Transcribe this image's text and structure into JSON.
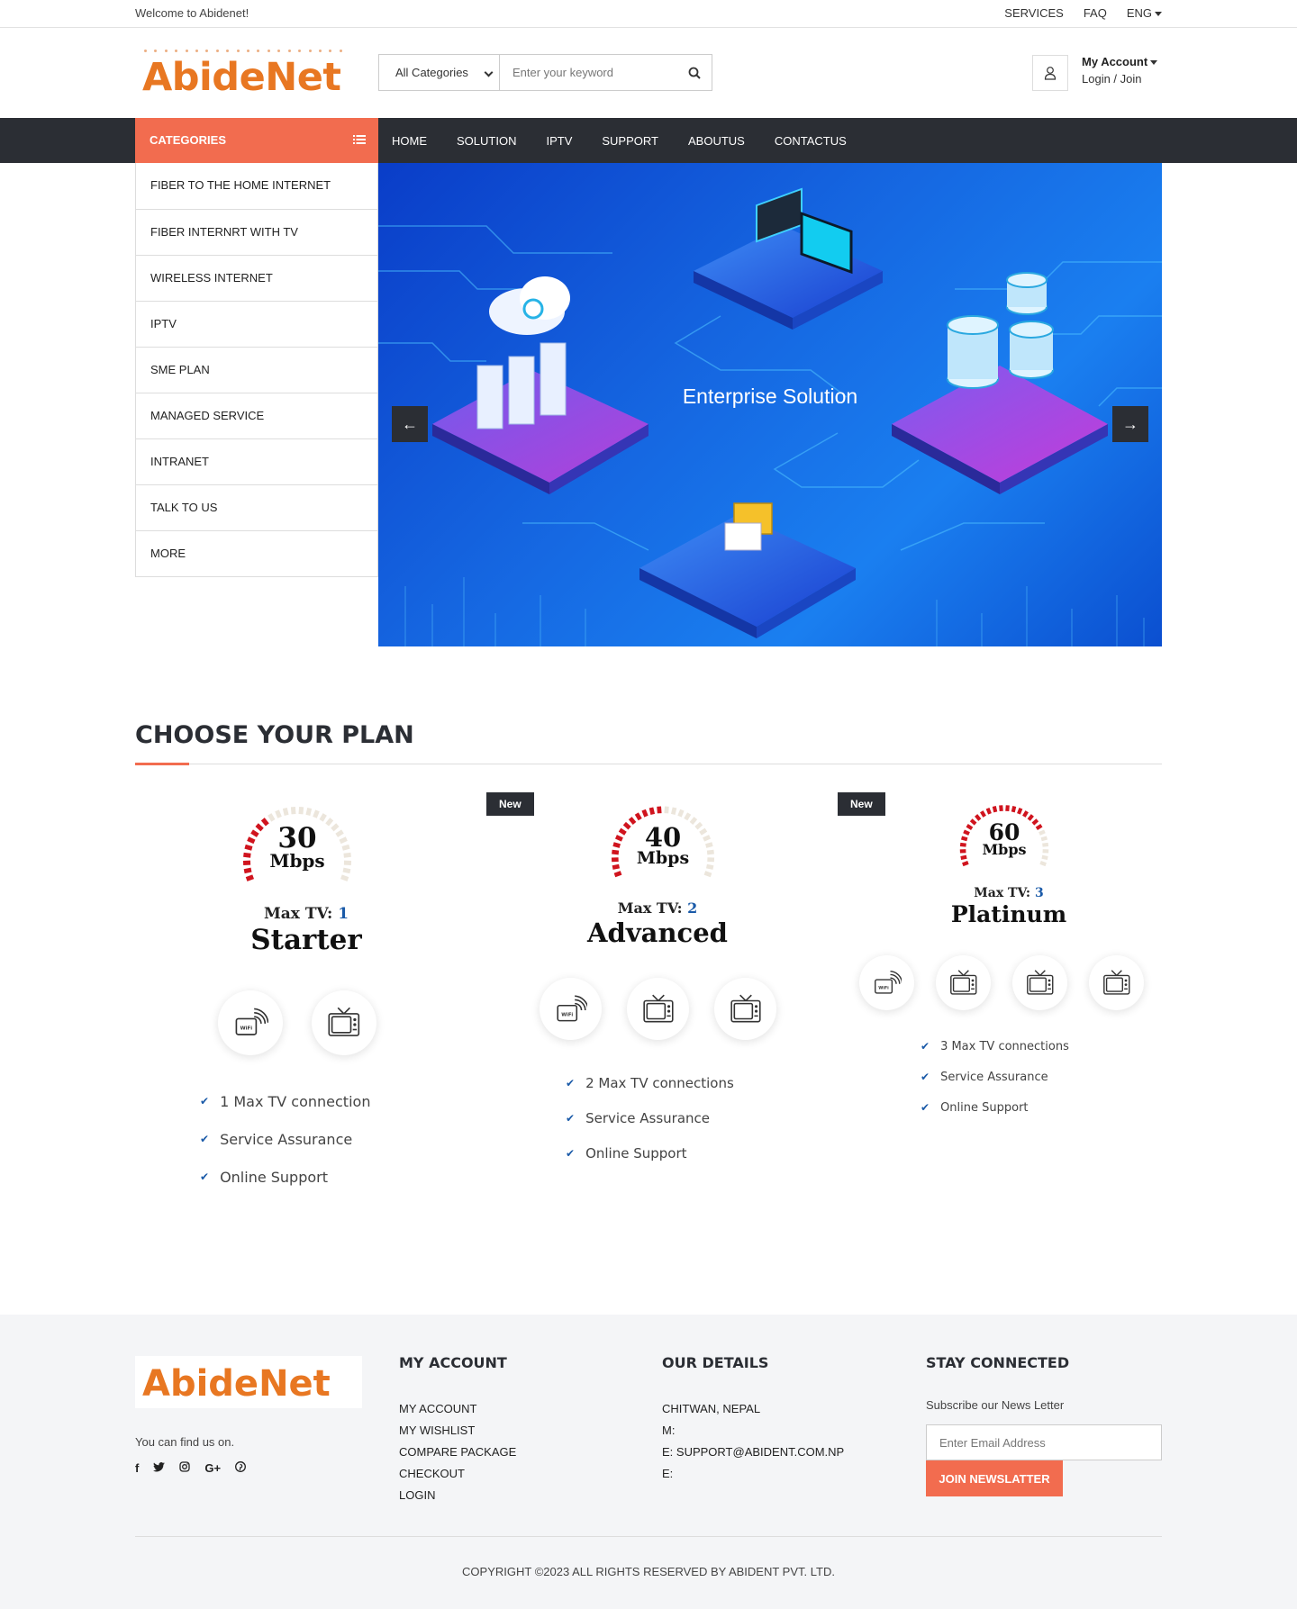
{
  "topbar": {
    "welcome": "Welcome to Abidenet!",
    "links": [
      "SERVICES",
      "FAQ",
      "ENG"
    ]
  },
  "header": {
    "logo_text": "AbideNet",
    "search": {
      "category": "All Categories",
      "placeholder": "Enter your keyword"
    },
    "account": {
      "title": "My Account",
      "subtitle": "Login / Join"
    }
  },
  "nav": {
    "categories_label": "CATEGORIES",
    "links": [
      "HOME",
      "SOLUTION",
      "IPTV",
      "SUPPORT",
      "ABOUTUS",
      "CONTACTUS"
    ]
  },
  "sidebar": {
    "items": [
      "FIBER TO THE HOME INTERNET",
      "FIBER INTERNRT WITH TV",
      "WIRELESS INTERNET",
      "IPTV",
      "SME PLAN",
      "MANAGED SERVICE",
      "INTRANET",
      "TALK TO US",
      "MORE"
    ]
  },
  "banner": {
    "caption": "Enterprise Solution",
    "prev": "←",
    "next": "→"
  },
  "plans_section": {
    "title": "CHOOSE YOUR PLAN",
    "plans": [
      {
        "speed": "30",
        "unit": "Mbps",
        "max_tv_label": "Max TV:",
        "max_tv": "1",
        "name": "Starter",
        "badge": "",
        "gauge_fill": 0.35,
        "features": [
          "1 Max TV connection",
          "Service Assurance",
          "Online Support"
        ]
      },
      {
        "speed": "40",
        "unit": "Mbps",
        "max_tv_label": "Max TV:",
        "max_tv": "2",
        "name": "Advanced",
        "badge": "New",
        "gauge_fill": 0.5,
        "features": [
          "2 Max TV connections",
          "Service Assurance",
          "Online Support"
        ]
      },
      {
        "speed": "60",
        "unit": "Mbps",
        "max_tv_label": "Max TV:",
        "max_tv": "3",
        "name": "Platinum",
        "badge": "New",
        "gauge_fill": 0.78,
        "features": [
          "3 Max TV connections",
          "Service Assurance",
          "Online Support"
        ]
      }
    ]
  },
  "footer": {
    "logo_text": "AbideNet",
    "find_us": "You can find us on.",
    "social": [
      "f",
      "t",
      "ig",
      "G+",
      "p"
    ],
    "my_account": {
      "title": "MY ACCOUNT",
      "links": [
        "MY ACCOUNT",
        "MY WISHLIST",
        "COMPARE PACKAGE",
        "CHECKOUT",
        "LOGIN"
      ]
    },
    "our_details": {
      "title": "OUR DETAILS",
      "lines": [
        "CHITWAN, NEPAL",
        "M:",
        "E: SUPPORT@ABIDENT.COM.NP",
        "E:"
      ]
    },
    "stay_connected": {
      "title": "STAY CONNECTED",
      "label": "Subscribe our News Letter",
      "placeholder": "Enter Email Address",
      "button": "JOIN NEWSLATTER"
    },
    "copyright": "COPYRIGHT ©2023 ALL RIGHTS RESERVED BY ABIDENT PVT. LTD."
  },
  "colors": {
    "accent": "#f26c4f",
    "dark": "#2b2e34",
    "logo": "#e87722",
    "gauge_red": "#d0141e",
    "gauge_grey": "#ece6dc",
    "tv_blue": "#1a5aa8"
  }
}
